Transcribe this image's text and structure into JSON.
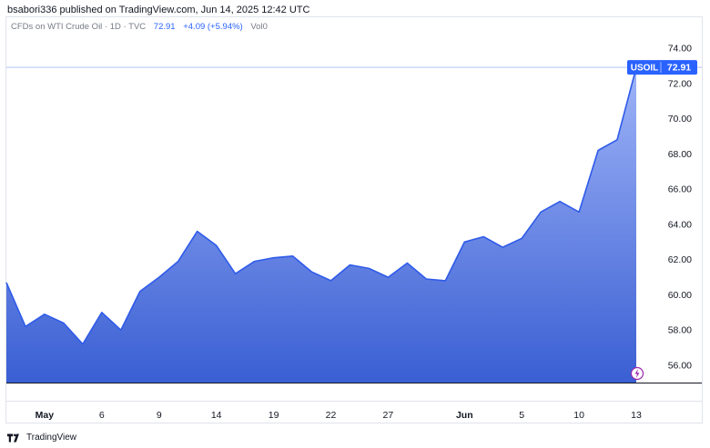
{
  "header": {
    "publisher_line": "bsabori336 published on TradingView.com, Jun 14, 2025 12:42 UTC"
  },
  "legend": {
    "symbol_desc": "CFDs on WTI Crude Oil · 1D · TVC",
    "last": "72.91",
    "change": "+4.09 (+5.94%)",
    "volume": "Vol0"
  },
  "price_tag": {
    "symbol": "USOIL",
    "value": "72.91"
  },
  "footer": {
    "brand": "TradingView"
  },
  "colors": {
    "accent": "#2962ff",
    "area_top": "#9fb4f7",
    "area_bottom": "#3a5fd3",
    "line": "#2f5bea"
  },
  "icons": {
    "alert": "lightning-icon",
    "brand": "tv-logo-icon"
  },
  "chart_data": {
    "type": "area",
    "title": "",
    "xlabel": "",
    "ylabel": "",
    "ylim": [
      55,
      75
    ],
    "yticks": [
      56,
      58,
      60,
      62,
      64,
      66,
      68,
      70,
      72,
      74
    ],
    "ytick_labels": [
      "56.00",
      "58.00",
      "60.00",
      "62.00",
      "64.00",
      "66.00",
      "68.00",
      "70.00",
      "72.00",
      "74.00"
    ],
    "x_tick_labels": [
      {
        "label": "May",
        "index": 2
      },
      {
        "label": "6",
        "index": 5
      },
      {
        "label": "9",
        "index": 8
      },
      {
        "label": "14",
        "index": 11
      },
      {
        "label": "19",
        "index": 14
      },
      {
        "label": "22",
        "index": 17
      },
      {
        "label": "27",
        "index": 20
      },
      {
        "label": "Jun",
        "index": 24
      },
      {
        "label": "5",
        "index": 27
      },
      {
        "label": "10",
        "index": 30
      },
      {
        "label": "13",
        "index": 33
      }
    ],
    "series": [
      {
        "values": [
          60.7,
          58.2,
          58.9,
          58.4,
          57.2,
          59.0,
          58.0,
          60.2,
          61.0,
          61.9,
          63.6,
          62.8,
          61.2,
          61.9,
          62.1,
          62.2,
          61.3,
          60.8,
          61.7,
          61.5,
          61.0,
          61.8,
          60.9,
          60.8,
          63.0,
          63.3,
          62.7,
          63.2,
          64.7,
          65.3,
          64.7,
          68.2,
          68.8,
          72.9
        ]
      }
    ],
    "last_value": 72.91,
    "grid": false
  }
}
